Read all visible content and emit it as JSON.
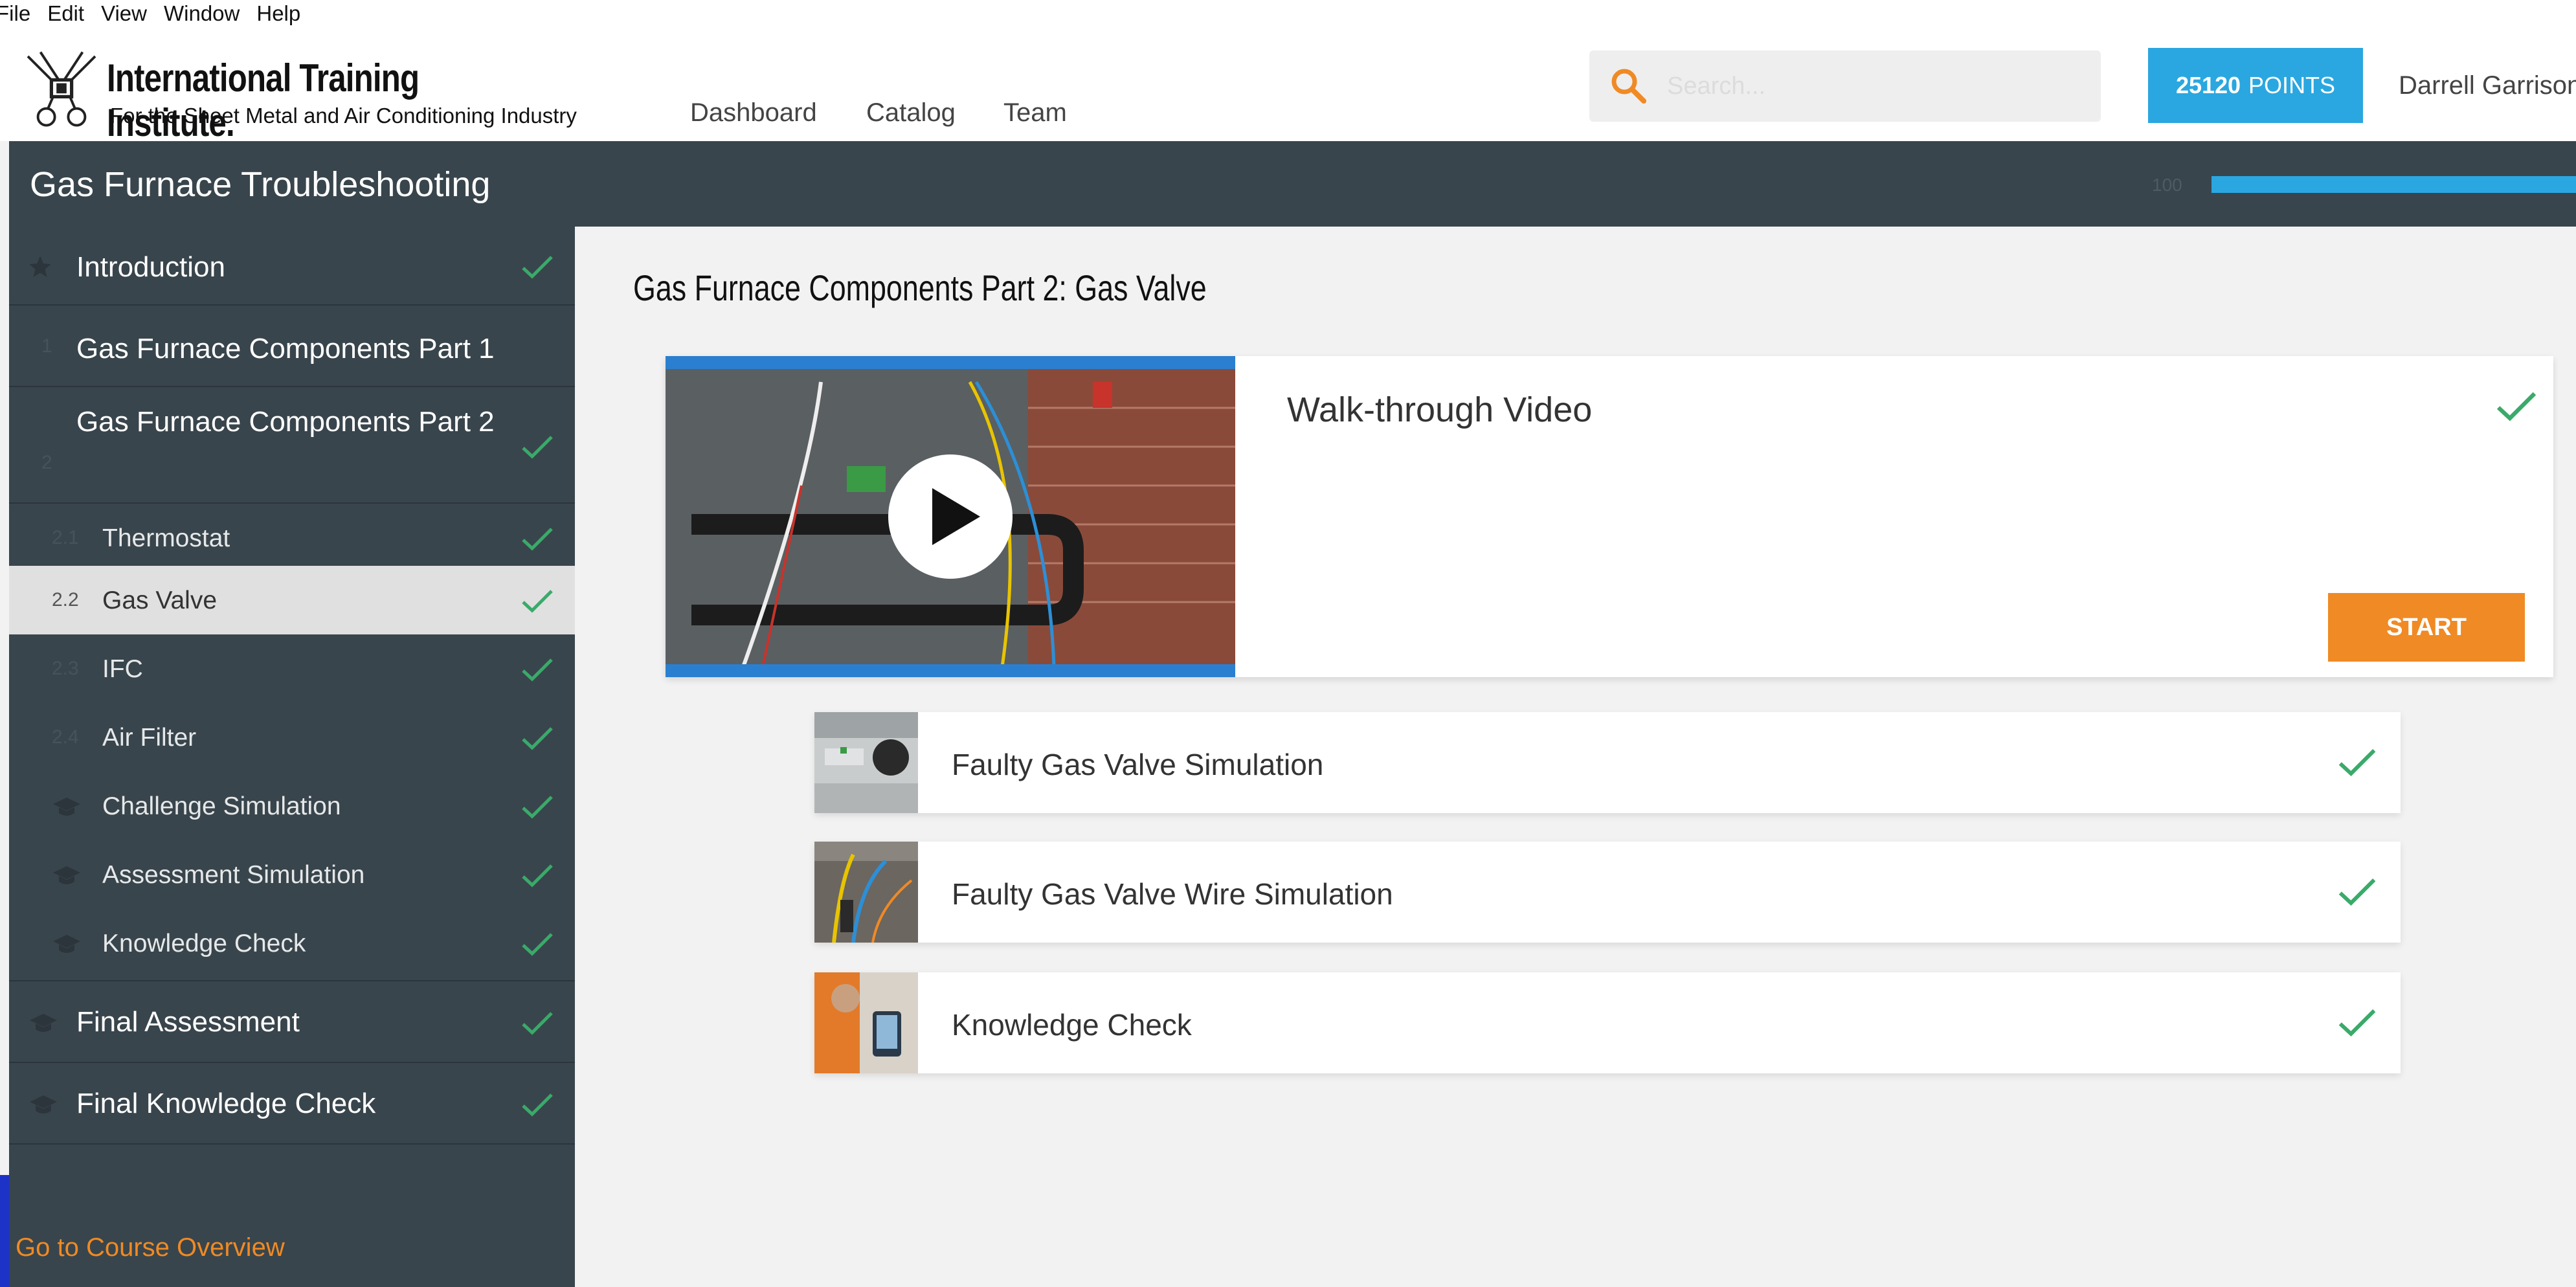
{
  "menubar": {
    "file": "File",
    "edit": "Edit",
    "view": "View",
    "window": "Window",
    "help": "Help"
  },
  "logo": {
    "name": "International Training Institute.",
    "tagline": "For the Sheet Metal and Air Conditioning Industry"
  },
  "nav": {
    "dashboard": "Dashboard",
    "catalog": "Catalog",
    "team": "Team"
  },
  "search": {
    "placeholder": "Search..."
  },
  "points": {
    "value": "25120",
    "label": "POINTS"
  },
  "user": {
    "name": "Darrell Garrison"
  },
  "course": {
    "title": "Gas Furnace Troubleshooting",
    "progress_fraction": 1.0
  },
  "sidebar": {
    "items": [
      {
        "num": "",
        "label": "Introduction",
        "icon": "star-icon"
      },
      {
        "num": "1",
        "label": "Gas Furnace Components Part 1"
      },
      {
        "num": "2",
        "label": "Gas Furnace Components Part 2"
      },
      {
        "num": "2.1",
        "label": "Thermostat"
      },
      {
        "num": "2.2",
        "label": "Gas Valve"
      },
      {
        "num": "2.3",
        "label": "IFC"
      },
      {
        "num": "2.4",
        "label": "Air Filter"
      },
      {
        "num": "",
        "label": "Challenge Simulation",
        "icon": "graduation-cap-icon"
      },
      {
        "num": "",
        "label": "Assessment Simulation",
        "icon": "graduation-cap-icon"
      },
      {
        "num": "",
        "label": "Knowledge Check",
        "icon": "graduation-cap-icon"
      },
      {
        "num": "",
        "label": "Final Assessment",
        "icon": "graduation-cap-icon"
      },
      {
        "num": "",
        "label": "Final Knowledge Check",
        "icon": "graduation-cap-icon"
      }
    ],
    "overview_link": "Go to Course Overview"
  },
  "main": {
    "title": "Gas Furnace Components Part 2: Gas Valve",
    "video": {
      "title": "Walk-through Video",
      "start": "START"
    },
    "activities": [
      {
        "label": "Faulty Gas Valve Simulation"
      },
      {
        "label": "Faulty Gas Valve Wire Simulation"
      },
      {
        "label": "Knowledge Check"
      }
    ]
  },
  "colors": {
    "accent": "#2aa7e0",
    "orange": "#f08a24",
    "sidebar": "#39454c",
    "check": "#3aaa6a"
  }
}
